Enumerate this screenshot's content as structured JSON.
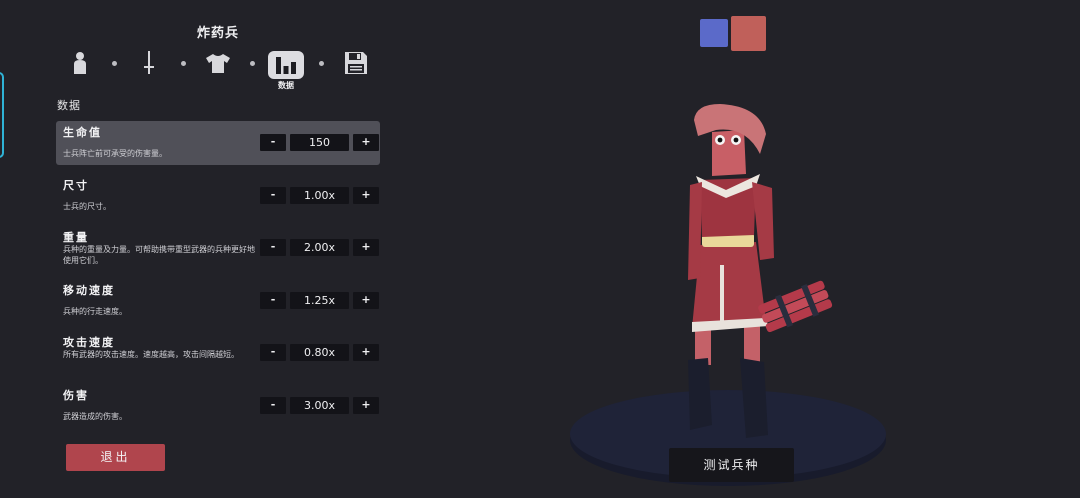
{
  "header": {
    "unit_name": "炸药兵"
  },
  "tabs": {
    "items": [
      {
        "id": "unit-base",
        "icon": "person-icon"
      },
      {
        "id": "weapons",
        "icon": "sword-icon"
      },
      {
        "id": "clothing",
        "icon": "shirt-icon"
      },
      {
        "id": "stats",
        "icon": "bar-chart-icon",
        "label": "数据",
        "active": true
      },
      {
        "id": "save",
        "icon": "floppy-disk-icon"
      }
    ],
    "active_label": "数据"
  },
  "stats_section": {
    "title": "数据",
    "rows": [
      {
        "name": "生命值",
        "description": "士兵阵亡前可承受的伤害量。",
        "value": "150"
      },
      {
        "name": "尺寸",
        "description": "士兵的尺寸。",
        "value": "1.00x"
      },
      {
        "name": "重量",
        "description": "兵种的重量及力量。可帮助携带重型武器的兵种更好地使用它们。",
        "value": "2.00x"
      },
      {
        "name": "移动速度",
        "description": "兵种的行走速度。",
        "value": "1.25x"
      },
      {
        "name": "攻击速度",
        "description": "所有武器的攻击速度。速度越高，攻击间隔越短。",
        "value": "0.80x"
      },
      {
        "name": "伤害",
        "description": "武器造成的伤害。",
        "value": "3.00x"
      }
    ],
    "decrement_label": "-",
    "increment_label": "+"
  },
  "footer": {
    "exit_label": "退出",
    "test_unit_label": "测试兵种"
  },
  "team_colors": {
    "blue": "#5b6ac9",
    "red": "#c0605a"
  },
  "colors": {
    "background": "#222228",
    "accent_red": "#b0454d",
    "selection": "#505058"
  }
}
